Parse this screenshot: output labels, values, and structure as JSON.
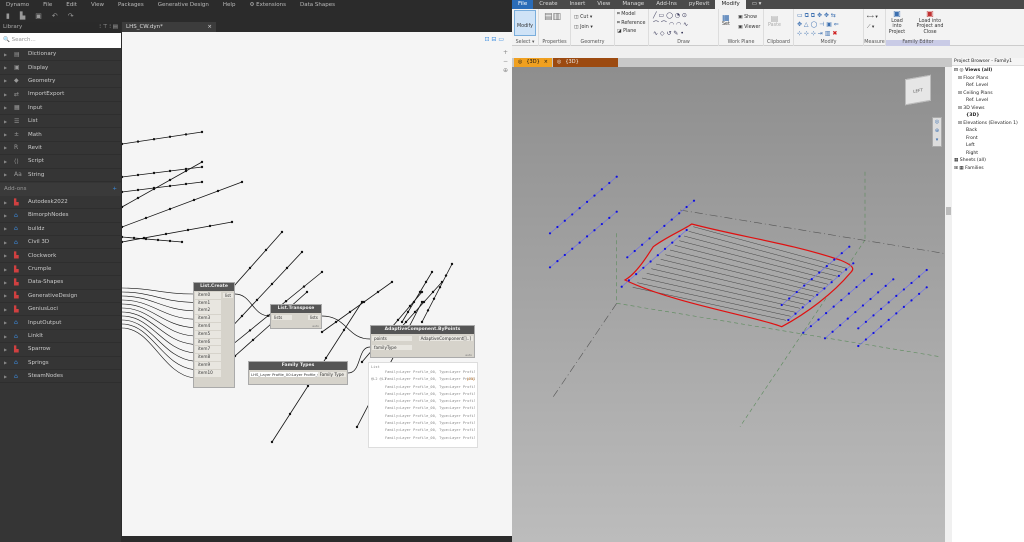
{
  "dynamo": {
    "menu": [
      "Dynamo",
      "File",
      "Edit",
      "View",
      "Packages",
      "Generative Design",
      "Help",
      "⚙ Extensions",
      "Data Shapes"
    ],
    "library": {
      "title": "Library",
      "search_placeholder": "Search...",
      "core": [
        "Dictionary",
        "Display",
        "Geometry",
        "ImportExport",
        "Input",
        "List",
        "Math",
        "Revit",
        "Script",
        "String"
      ],
      "addons_title": "Add-ons",
      "addons": [
        {
          "n": "Autodesk2022",
          "c": "c"
        },
        {
          "n": "BimorphNodes",
          "c": "b"
        },
        {
          "n": "buildz",
          "c": "b"
        },
        {
          "n": "Civil 3D",
          "c": "b"
        },
        {
          "n": "Clockwork",
          "c": "c"
        },
        {
          "n": "Crumple",
          "c": "c"
        },
        {
          "n": "Data-Shapes",
          "c": "c"
        },
        {
          "n": "GenerativeDesign",
          "c": "c"
        },
        {
          "n": "GeniusLoci",
          "c": "c"
        },
        {
          "n": "InputOutput",
          "c": "b"
        },
        {
          "n": "LinkIt",
          "c": "b"
        },
        {
          "n": "Sparrow",
          "c": "c"
        },
        {
          "n": "Springs",
          "c": "b"
        },
        {
          "n": "SteamNodes",
          "c": "b"
        }
      ]
    },
    "tab": "LHS_CW.dyn*",
    "nodes": {
      "list_create": {
        "title": "List.Create",
        "inputs": [
          "item0",
          "item1",
          "item2",
          "item3",
          "item4",
          "item5",
          "item6",
          "item7",
          "item8",
          "item9",
          "item10"
        ],
        "output": "list"
      },
      "transpose": {
        "title": "List.Transpose",
        "input": "lists",
        "output": "lists",
        "lacing": "auto"
      },
      "family_types": {
        "title": "Family Types",
        "value": "LHS_Layer Profile_00:Layer Profile_00",
        "output": "Family Type"
      },
      "adaptive": {
        "title": "AdaptiveComponent.ByPoints",
        "inputs": [
          "points",
          "familyType"
        ],
        "output": "AdaptiveComponent[]..]",
        "lacing": "auto"
      }
    },
    "preview": {
      "header": "List",
      "rows": [
        "Family=Layer Profile_00, Type=Layer Profil",
        "Family=Layer Profile_00, Type=Layer Profil",
        "Family=Layer Profile_00, Type=Layer Profil",
        "Family=Layer Profile_00, Type=Layer Profil",
        "Family=Layer Profile_00, Type=Layer Profil",
        "Family=Layer Profile_00, Type=Layer Profil",
        "Family=Layer Profile_00, Type=Layer Profil",
        "Family=Layer Profile_00, Type=Layer Profil",
        "Family=Layer Profile_00, Type=Layer Profil",
        "Family=Layer Profile_00, Type=Layer Profil"
      ],
      "footer": "@L2 @L1",
      "count": "{10}"
    }
  },
  "revit": {
    "tabs": [
      "File",
      "Create",
      "Insert",
      "View",
      "Manage",
      "Add-Ins",
      "pyRevit",
      "Modify",
      "▭ ▾"
    ],
    "ribbon": {
      "modify": "Modify",
      "select": "Select ▾",
      "properties": "Properties",
      "geometry": "Geometry",
      "cut": "Cut",
      "join": "Join",
      "model": "Model",
      "reference": "Reference",
      "plane": "Plane",
      "draw": "Draw",
      "set": "Set",
      "show": "Show",
      "viewer": "Viewer",
      "work_plane": "Work Plane",
      "paste": "Paste",
      "clipboard": "Clipboard",
      "modify_panel": "Modify",
      "measure": "Measure",
      "load_into_project": "Load into Project",
      "load_close": "Load into Project and Close",
      "family_editor": "Family Editor"
    },
    "view_tabs": [
      "{3D}",
      "{3D}"
    ],
    "viewcube": "LEFT",
    "browser": {
      "title": "Project Browser - Family1",
      "items": [
        {
          "t": "⊟ ◎ Views (all)",
          "d": 0,
          "b": true
        },
        {
          "t": "⊟ Floor Plans",
          "d": 1
        },
        {
          "t": "Ref. Level",
          "d": 3
        },
        {
          "t": "⊟ Ceiling Plans",
          "d": 1
        },
        {
          "t": "Ref. Level",
          "d": 3
        },
        {
          "t": "⊟ 3D Views",
          "d": 1
        },
        {
          "t": "{3D}",
          "d": 3,
          "b": true
        },
        {
          "t": "⊟ Elevations (Elevation 1)",
          "d": 1
        },
        {
          "t": "Back",
          "d": 3
        },
        {
          "t": "Front",
          "d": 3
        },
        {
          "t": "Left",
          "d": 3
        },
        {
          "t": "Right",
          "d": 3
        },
        {
          "t": "▦ Sheets (all)",
          "d": 0
        },
        {
          "t": "⊞ ▦ Families",
          "d": 0
        }
      ]
    }
  }
}
